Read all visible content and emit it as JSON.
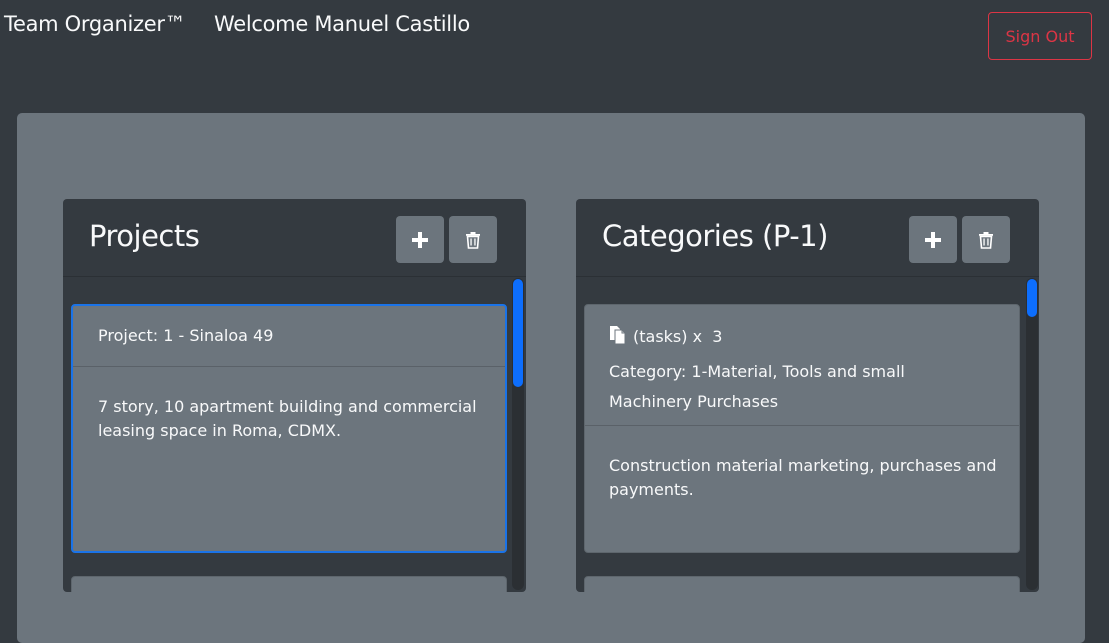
{
  "header": {
    "brand": "Team Organizer™",
    "welcome": "Welcome Manuel Castillo",
    "sign_out_label": "Sign Out"
  },
  "projects_panel": {
    "title": "Projects",
    "add_icon": "plus-icon",
    "delete_icon": "trash-icon",
    "cards": [
      {
        "header": "Project: 1 - Sinaloa 49",
        "description": "7 story, 10 apartment building and commercial leasing space in Roma, CDMX."
      }
    ]
  },
  "categories_panel": {
    "title": "Categories (P-1)",
    "add_icon": "plus-icon",
    "delete_icon": "trash-icon",
    "cards": [
      {
        "tasks_label": "(tasks) x  3",
        "category": "Category: 1-Material, Tools and small Machinery Purchases",
        "description": "Construction material marketing, purchases and payments."
      }
    ]
  },
  "colors": {
    "background": "#343a40",
    "board": "#6c757d",
    "danger": "#dc3545",
    "accent": "#1a73e8"
  }
}
